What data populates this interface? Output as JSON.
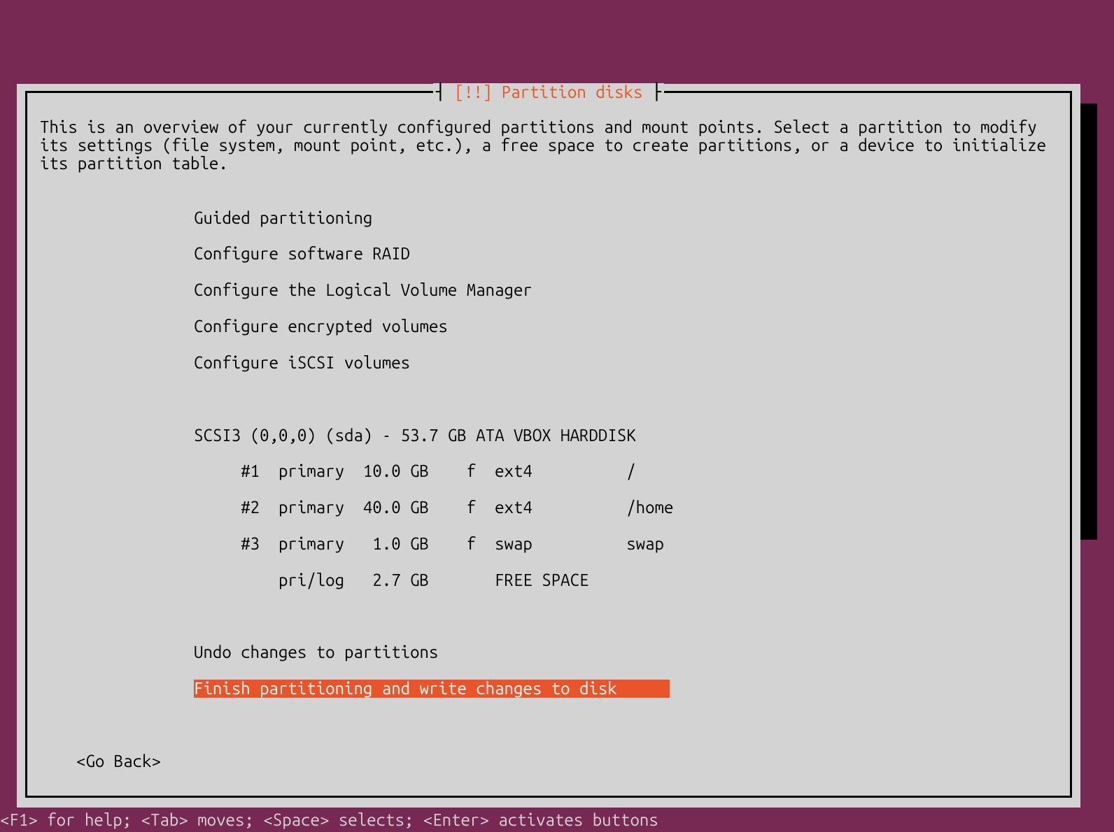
{
  "dialog": {
    "title": "[!!] Partition disks",
    "description": "This is an overview of your currently configured partitions and mount points. Select a partition to modify its settings (file system, mount point, etc.), a free space to create partitions, or a device to initialize its partition table.",
    "menu": {
      "config_items": [
        "Guided partitioning",
        "Configure software RAID",
        "Configure the Logical Volume Manager",
        "Configure encrypted volumes",
        "Configure iSCSI volumes"
      ],
      "device_header": "SCSI3 (0,0,0) (sda) - 53.7 GB ATA VBOX HARDDISK",
      "partitions": [
        "     #1  primary  10.0 GB    f  ext4          /",
        "     #2  primary  40.0 GB    f  ext4          /home",
        "     #3  primary   1.0 GB    f  swap          swap",
        "         pri/log   2.7 GB       FREE SPACE"
      ],
      "undo": "Undo changes to partitions",
      "finish": "Finish partitioning and write changes to disk"
    },
    "go_back": "<Go Back>"
  },
  "statusbar": "<F1> for help; <Tab> moves; <Space> selects; <Enter> activates buttons"
}
